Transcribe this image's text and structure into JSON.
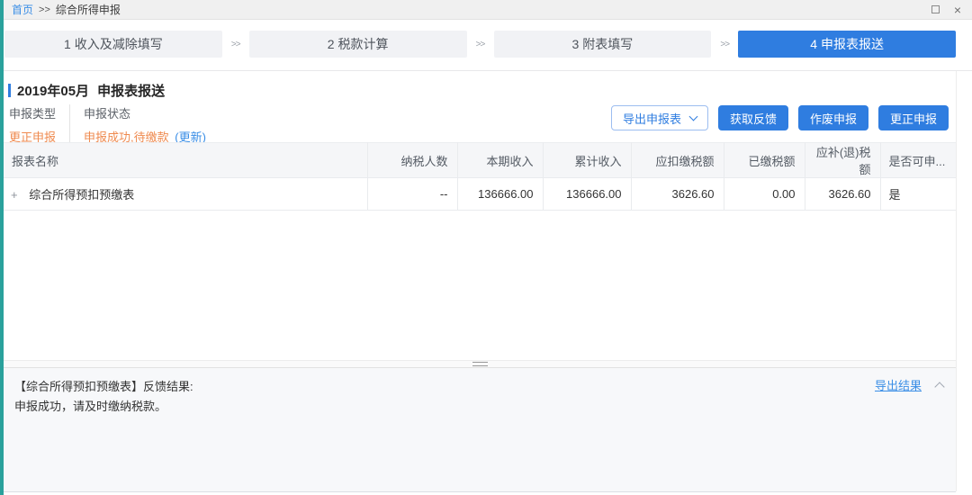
{
  "colors": {
    "accent": "#2f7de0",
    "warning": "#ef8a4f",
    "success": "#43b26d",
    "link": "#3a8ee6",
    "teal": "#2aa19c"
  },
  "breadcrumb": {
    "home": "首页",
    "separator": ">>",
    "current": "综合所得申报"
  },
  "wizard": {
    "separator": ">>",
    "steps": [
      {
        "label": "1 收入及减除填写"
      },
      {
        "label": "2 税款计算"
      },
      {
        "label": "3 附表填写"
      },
      {
        "label": "4 申报表报送"
      }
    ]
  },
  "section": {
    "period": "2019年05月",
    "title": "申报表报送",
    "declare_type_label": "申报类型",
    "declare_type_value": "更正申报",
    "declare_status_label": "申报状态",
    "declare_status_value": "申报成功,待缴款",
    "refresh_link": "(更新)"
  },
  "toolbar": {
    "export_label": "导出申报表",
    "feedback_label": "获取反馈",
    "void_label": "作废申报",
    "correct_label": "更正申报"
  },
  "table": {
    "headers": [
      "报表名称",
      "纳税人数",
      "本期收入",
      "累计收入",
      "应扣缴税额",
      "已缴税额",
      "应补(退)税额",
      "是否可申..."
    ],
    "rows": [
      {
        "expand": "+",
        "name": "综合所得预扣预缴表",
        "taxpayer_count": "--",
        "current_income": "136666.00",
        "total_income": "136666.00",
        "withhold_tax": "3626.60",
        "paid_tax": "0.00",
        "refund_tax": "3626.60",
        "declarable": "是"
      }
    ]
  },
  "feedback": {
    "title": "【综合所得预扣预缴表】反馈结果:",
    "message": "申报成功，请及时缴纳税款。",
    "export_link": "导出结果"
  }
}
